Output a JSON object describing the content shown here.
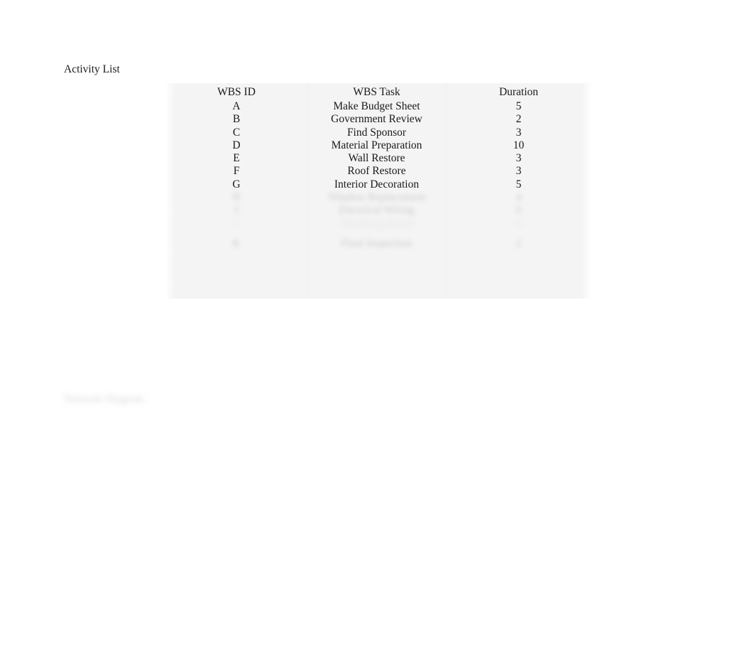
{
  "page": {
    "background": "#ffffff",
    "text_color": "#1a1a1a"
  },
  "activity_list": {
    "caption": "Activity List",
    "table": {
      "columns": [
        "WBS ID",
        "WBS Task",
        "Duration"
      ],
      "rows": [
        {
          "id": "A",
          "task": "Make Budget Sheet",
          "duration": "5"
        },
        {
          "id": "B",
          "task": "Government Review",
          "duration": "2"
        },
        {
          "id": "C",
          "task": "Find Sponsor",
          "duration": "3"
        },
        {
          "id": "D",
          "task": "Material Preparation",
          "duration": "10"
        },
        {
          "id": "E",
          "task": "Wall Restore",
          "duration": "3"
        },
        {
          "id": "F",
          "task": "Roof Restore",
          "duration": "3"
        },
        {
          "id": "G",
          "task": "Interior Decoration",
          "duration": "5"
        }
      ],
      "obscured_rows": [
        {
          "id": "H",
          "task": "Window Replacement",
          "duration": "4"
        },
        {
          "id": "I",
          "task": "Electrical Wiring",
          "duration": "6"
        },
        {
          "id": "J",
          "task": "Plumbing Install",
          "duration": "4"
        },
        {
          "id": "K",
          "task": "Final Inspection",
          "duration": "2"
        }
      ]
    }
  },
  "bottom_caption": {
    "text": "Network Diagram"
  }
}
